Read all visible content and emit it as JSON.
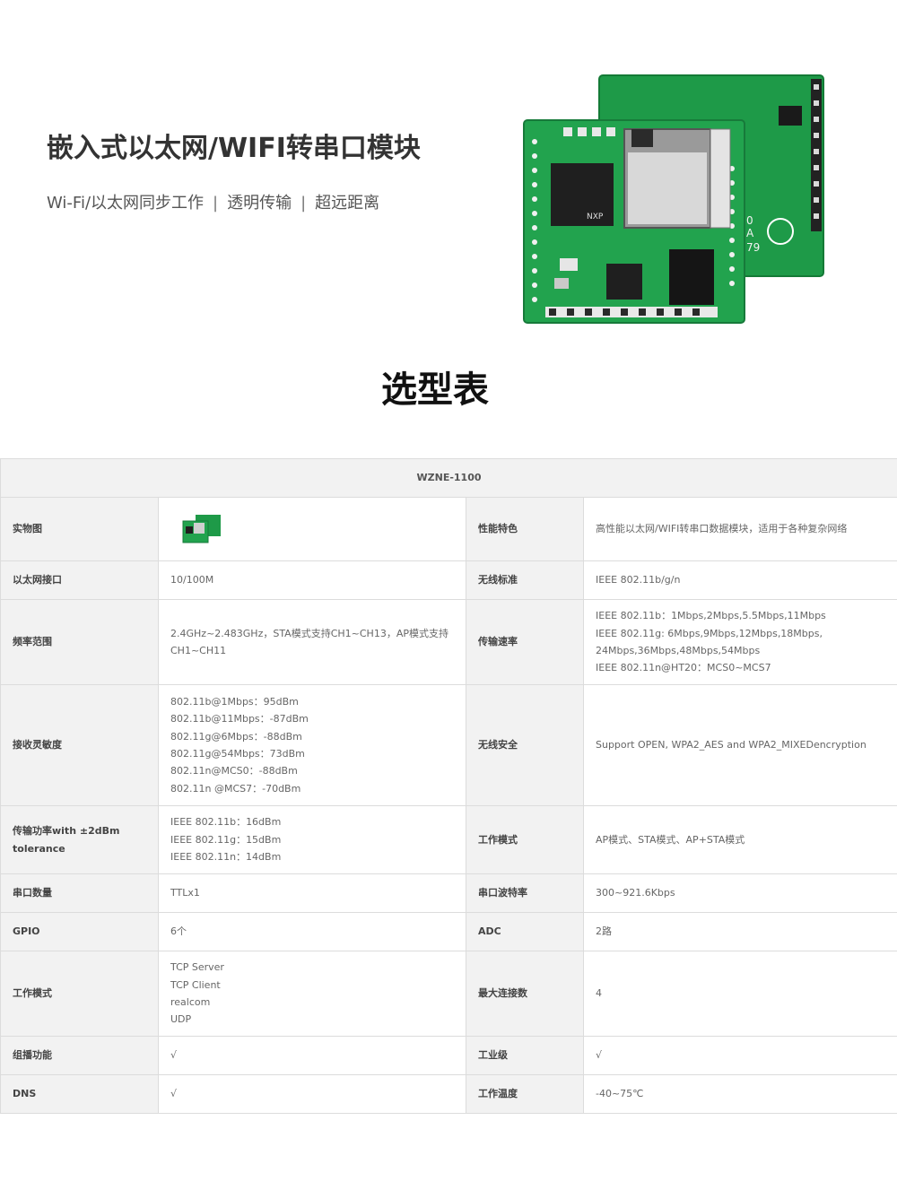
{
  "hero": {
    "title": "嵌入式以太网/WIFI转串口模块",
    "features": [
      "Wi-Fi/以太网同步工作",
      "透明传输",
      "超远距离"
    ],
    "separator": "|"
  },
  "board_markings": {
    "chip": "NXP",
    "side_digits": "79",
    "side_letter": "A",
    "side_zero": "0"
  },
  "section_title": "选型表",
  "table": {
    "model": "WZNE-1100",
    "labels": {
      "photo": "实物图",
      "performance": "性能特色",
      "ethernet": "以太网接口",
      "wireless_std": "无线标准",
      "freq": "频率范围",
      "rate": "传输速率",
      "sensitivity": "接收灵敏度",
      "security": "无线安全",
      "tx_power": "传输功率with ±2dBm tolerance",
      "work_mode": "工作模式",
      "uart_count": "串口数量",
      "baud": "串口波特率",
      "gpio": "GPIO",
      "adc": "ADC",
      "work_mode2": "工作模式",
      "max_conn": "最大连接数",
      "multicast": "组播功能",
      "industrial": "工业级",
      "dns": "DNS",
      "temp": "工作温度"
    },
    "values": {
      "performance": "高性能以太网/WIFI转串口数据模块，适用于各种复杂网络",
      "ethernet": "10/100M",
      "wireless_std": "IEEE 802.11b/g/n",
      "freq": "2.4GHz~2.483GHz，STA模式支持CH1~CH13，AP模式支持CH1~CH11",
      "rate": [
        "IEEE 802.11b：1Mbps,2Mbps,5.5Mbps,11Mbps",
        "IEEE 802.11g: 6Mbps,9Mbps,12Mbps,18Mbps,",
        "24Mbps,36Mbps,48Mbps,54Mbps",
        "IEEE 802.11n@HT20：MCS0~MCS7"
      ],
      "sensitivity": [
        "802.11b@1Mbps：95dBm",
        "802.11b@11Mbps：-87dBm",
        "802.11g@6Mbps：-88dBm",
        "802.11g@54Mbps：73dBm",
        "802.11n@MCS0：-88dBm",
        "802.11n @MCS7：-70dBm"
      ],
      "security": "Support OPEN, WPA2_AES and WPA2_MIXEDencryption",
      "tx_power": [
        "IEEE 802.11b：16dBm",
        "IEEE 802.11g：15dBm",
        "IEEE 802.11n：14dBm"
      ],
      "work_mode": "AP模式、STA模式、AP+STA模式",
      "uart_count": "TTLx1",
      "baud": "300~921.6Kbps",
      "gpio": "6个",
      "adc": "2路",
      "work_mode2": [
        "TCP Server",
        "TCP Client",
        "realcom",
        "UDP"
      ],
      "max_conn": "4",
      "multicast": "√",
      "industrial": "√",
      "dns": "√",
      "temp": "-40~75℃"
    }
  },
  "colors": {
    "pcb_green": "#1f9a4a",
    "table_label_bg": "#f2f2f2",
    "border": "#dcdcdc"
  }
}
